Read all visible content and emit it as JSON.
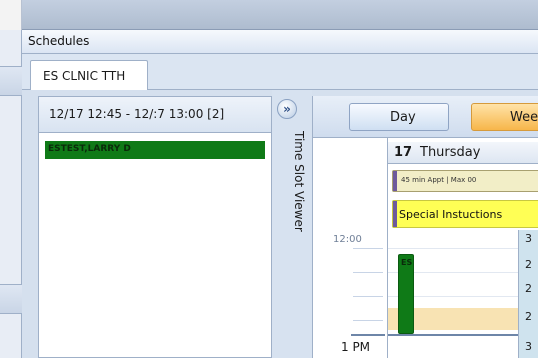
{
  "window": {
    "title": "Schedules"
  },
  "tabs": [
    {
      "label": "ES CLNIC TTH"
    }
  ],
  "slot_viewer": {
    "header": "12/17 12:45 - 12/:7 13:00  [2]",
    "items": [
      {
        "label": "ESTEST,LARRY D"
      }
    ],
    "side_label": "Time Slot Viewer"
  },
  "calendar": {
    "views": [
      {
        "label": "Day"
      },
      {
        "label": "Week"
      }
    ],
    "day": {
      "number": "17",
      "name": "Thursday"
    },
    "bands": [
      {
        "label": "45 min Appt | Max 00"
      },
      {
        "label": "Special Instuctions"
      }
    ],
    "time_labels": [
      "12:00",
      "1 PM"
    ],
    "appointment": {
      "label": "ES"
    },
    "counts": [
      "3",
      "2",
      "2",
      "2",
      "3"
    ]
  },
  "colors": {
    "accent_green": "#0f7a17",
    "week_tab": "#f7b64a",
    "special_band": "#ffff55",
    "highlight_row": "#f8e3b3"
  }
}
